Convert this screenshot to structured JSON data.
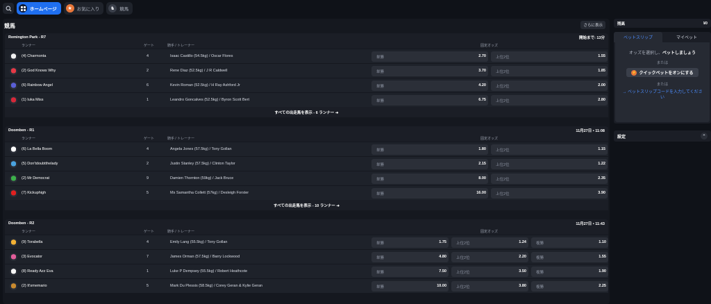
{
  "topbar": {
    "home_label": "ホームページ",
    "fav_label": "お気に入り",
    "horse_label": "競馬"
  },
  "main": {
    "title": "競馬",
    "see_more": "さらに表示",
    "col_runner": "ランナー",
    "col_gate": "ゲート",
    "col_jockey": "騎手 / トレーナー",
    "col_odds": "固定オッズ"
  },
  "races": [
    {
      "name": "Remington Park - R7",
      "time": "開始まで: 13分",
      "show_all": "すべての出走馬を表示 - 6 ランナー ➜",
      "runners": [
        {
          "name": "(4) Charmonta",
          "gate": "4",
          "jockey": "Isaac Castillo (54.5kg) / Oscar Flores",
          "win_label": "単勝",
          "win": "2.70",
          "place_label": "上位2位",
          "place": "1.55",
          "silk": "#f0f0f0"
        },
        {
          "name": "(2) God Knows Why",
          "gate": "2",
          "jockey": "Rene Diaz (52.5kg) / J R Caldwell",
          "win_label": "単勝",
          "win": "3.70",
          "place_label": "上位2位",
          "place": "1.85",
          "silk": "#e63946"
        },
        {
          "name": "(6) Rainbow Angel",
          "gate": "6",
          "jockey": "Kevin Roman (52.5kg) / H Ray Ashford Jr",
          "win_label": "単勝",
          "win": "4.20",
          "place_label": "上位2位",
          "place": "2.00",
          "silk": "#5a5fd6"
        },
        {
          "name": "(1) Iuka Miss",
          "gate": "1",
          "jockey": "Leandro Goncalves (52.5kg) / Byron Scott Bert",
          "win_label": "単勝",
          "win": "6.75",
          "place_label": "上位2位",
          "place": "2.80",
          "silk": "#d62839"
        }
      ]
    },
    {
      "name": "Doomben - R1",
      "time": "11月27日 • 11:08",
      "show_all": "すべての出走馬を表示 - 10 ランナー ➜",
      "runners": [
        {
          "name": "(6) La Bella Boom",
          "gate": "4",
          "jockey": "Angela Jones (57.5kg) / Tony Gollan",
          "win_label": "単勝",
          "win": "1.80",
          "place_label": "上位2位",
          "place": "1.15",
          "silk": "#ffffff"
        },
        {
          "name": "(5) Don'tdoubtthelady",
          "gate": "2",
          "jockey": "Justin Stanley (57.5kg) / Clinton Taylor",
          "win_label": "単勝",
          "win": "2.15",
          "place_label": "上位2位",
          "place": "1.22",
          "silk": "#4aa3df"
        },
        {
          "name": "(2) Mr Democrat",
          "gate": "9",
          "jockey": "Damien Thornton (59kg) / Jack Bruce",
          "win_label": "単勝",
          "win": "8.00",
          "place_label": "上位2位",
          "place": "2.35",
          "silk": "#3cb04a"
        },
        {
          "name": "(7) Kickuphigh",
          "gate": "5",
          "jockey": "Ms Samantha Collett (57kg) / Desleigh Forster",
          "win_label": "単勝",
          "win": "16.00",
          "place_label": "上位2位",
          "place": "3.90",
          "silk": "#e02020"
        }
      ]
    },
    {
      "name": "Doomben - R2",
      "time": "11月27日 • 11:43",
      "runners": [
        {
          "name": "(9) Torabella",
          "gate": "4",
          "jockey": "Emily Lang (55.5kg) / Tony Gollan",
          "win_label": "単勝",
          "win": "1.75",
          "place_label": "上位2位",
          "place": "1.24",
          "show_label": "複勝",
          "show": "1.10",
          "silk": "#f2b134"
        },
        {
          "name": "(3) Evocator",
          "gate": "7",
          "jockey": "James Orman (57.5kg) / Barry Lockwood",
          "win_label": "単勝",
          "win": "4.80",
          "place_label": "上位2位",
          "place": "2.20",
          "show_label": "複勝",
          "show": "1.55",
          "silk": "#e35d9a"
        },
        {
          "name": "(8) Ready Azz Eva",
          "gate": "1",
          "jockey": "Luke P Dempsey (55.5kg) / Robert Heathcote",
          "win_label": "単勝",
          "win": "7.50",
          "place_label": "上位2位",
          "place": "3.50",
          "show_label": "複勝",
          "show": "1.90",
          "silk": "#f5f5f5"
        },
        {
          "name": "(2) It'smemario",
          "gate": "5",
          "jockey": "Mark Du Plessis (58.5kg) / Corey Geran & Kylie Geran",
          "win_label": "単勝",
          "win": "10.00",
          "place_label": "上位2位",
          "place": "3.80",
          "show_label": "複勝",
          "show": "2.25",
          "silk": "#c98a2e"
        }
      ]
    }
  ],
  "side": {
    "balance_label": "残高",
    "balance_value": "¥0",
    "tab_betslip": "ベットスリップ",
    "tab_mybets": "マイベット",
    "prompt_pre": "オッズを選択し、",
    "prompt_bold": "ベットしましょう",
    "or1": "または",
    "quick_btn": "クイックベットをオンにする",
    "or2": "または",
    "code_link": "→ ベットスリップコードを入力してください",
    "settings": "設定"
  }
}
